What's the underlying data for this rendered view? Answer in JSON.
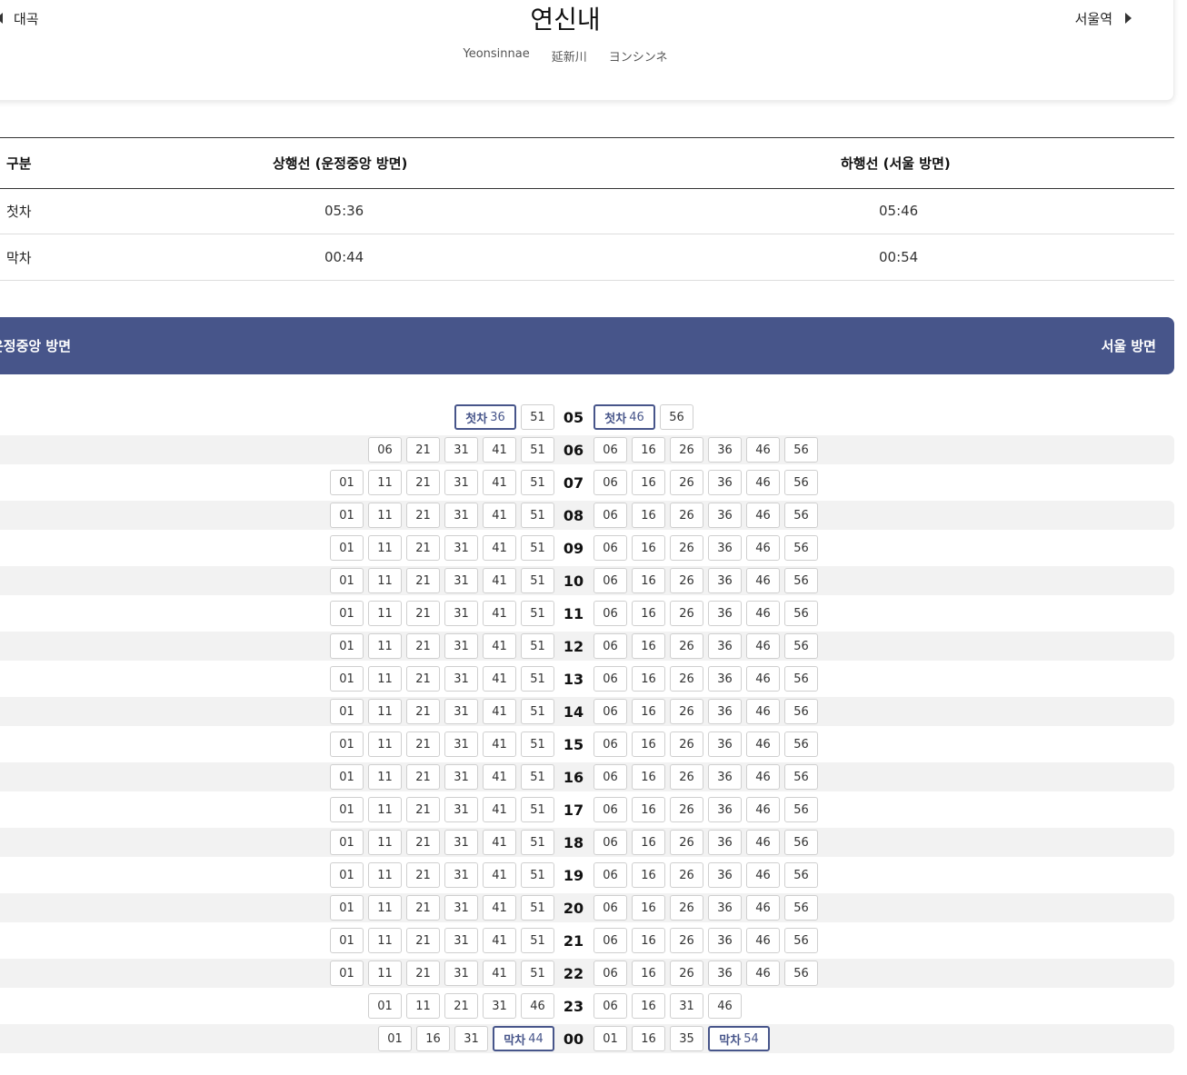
{
  "header": {
    "prev_station": "대곡",
    "next_station": "서울역",
    "title": "연신내",
    "sub_en": "Yeonsinnae",
    "sub_hanja": "延新川",
    "sub_jp": "ヨンシンネ"
  },
  "summary": {
    "headers": {
      "label": "구분",
      "up": "상행선 (운정중앙 방면)",
      "down": "하행선 (서울 방면)"
    },
    "first": {
      "label": "첫차",
      "up": "05:36",
      "down": "05:46"
    },
    "last": {
      "label": "막차",
      "up": "00:44",
      "down": "00:54"
    }
  },
  "direction_bar": {
    "left": "운정중앙 방면",
    "right": "서울 방면"
  },
  "first_tag": "첫차",
  "last_tag": "막차",
  "timetable": [
    {
      "hour": "05",
      "up": [
        "36",
        "51"
      ],
      "down": [
        "46",
        "56"
      ],
      "up_first": true,
      "down_first": true
    },
    {
      "hour": "06",
      "up": [
        "06",
        "21",
        "31",
        "41",
        "51"
      ],
      "down": [
        "06",
        "16",
        "26",
        "36",
        "46",
        "56"
      ]
    },
    {
      "hour": "07",
      "up": [
        "01",
        "11",
        "21",
        "31",
        "41",
        "51"
      ],
      "down": [
        "06",
        "16",
        "26",
        "36",
        "46",
        "56"
      ]
    },
    {
      "hour": "08",
      "up": [
        "01",
        "11",
        "21",
        "31",
        "41",
        "51"
      ],
      "down": [
        "06",
        "16",
        "26",
        "36",
        "46",
        "56"
      ]
    },
    {
      "hour": "09",
      "up": [
        "01",
        "11",
        "21",
        "31",
        "41",
        "51"
      ],
      "down": [
        "06",
        "16",
        "26",
        "36",
        "46",
        "56"
      ]
    },
    {
      "hour": "10",
      "up": [
        "01",
        "11",
        "21",
        "31",
        "41",
        "51"
      ],
      "down": [
        "06",
        "16",
        "26",
        "36",
        "46",
        "56"
      ]
    },
    {
      "hour": "11",
      "up": [
        "01",
        "11",
        "21",
        "31",
        "41",
        "51"
      ],
      "down": [
        "06",
        "16",
        "26",
        "36",
        "46",
        "56"
      ]
    },
    {
      "hour": "12",
      "up": [
        "01",
        "11",
        "21",
        "31",
        "41",
        "51"
      ],
      "down": [
        "06",
        "16",
        "26",
        "36",
        "46",
        "56"
      ]
    },
    {
      "hour": "13",
      "up": [
        "01",
        "11",
        "21",
        "31",
        "41",
        "51"
      ],
      "down": [
        "06",
        "16",
        "26",
        "36",
        "46",
        "56"
      ]
    },
    {
      "hour": "14",
      "up": [
        "01",
        "11",
        "21",
        "31",
        "41",
        "51"
      ],
      "down": [
        "06",
        "16",
        "26",
        "36",
        "46",
        "56"
      ]
    },
    {
      "hour": "15",
      "up": [
        "01",
        "11",
        "21",
        "31",
        "41",
        "51"
      ],
      "down": [
        "06",
        "16",
        "26",
        "36",
        "46",
        "56"
      ]
    },
    {
      "hour": "16",
      "up": [
        "01",
        "11",
        "21",
        "31",
        "41",
        "51"
      ],
      "down": [
        "06",
        "16",
        "26",
        "36",
        "46",
        "56"
      ]
    },
    {
      "hour": "17",
      "up": [
        "01",
        "11",
        "21",
        "31",
        "41",
        "51"
      ],
      "down": [
        "06",
        "16",
        "26",
        "36",
        "46",
        "56"
      ]
    },
    {
      "hour": "18",
      "up": [
        "01",
        "11",
        "21",
        "31",
        "41",
        "51"
      ],
      "down": [
        "06",
        "16",
        "26",
        "36",
        "46",
        "56"
      ]
    },
    {
      "hour": "19",
      "up": [
        "01",
        "11",
        "21",
        "31",
        "41",
        "51"
      ],
      "down": [
        "06",
        "16",
        "26",
        "36",
        "46",
        "56"
      ]
    },
    {
      "hour": "20",
      "up": [
        "01",
        "11",
        "21",
        "31",
        "41",
        "51"
      ],
      "down": [
        "06",
        "16",
        "26",
        "36",
        "46",
        "56"
      ]
    },
    {
      "hour": "21",
      "up": [
        "01",
        "11",
        "21",
        "31",
        "41",
        "51"
      ],
      "down": [
        "06",
        "16",
        "26",
        "36",
        "46",
        "56"
      ]
    },
    {
      "hour": "22",
      "up": [
        "01",
        "11",
        "21",
        "31",
        "41",
        "51"
      ],
      "down": [
        "06",
        "16",
        "26",
        "36",
        "46",
        "56"
      ]
    },
    {
      "hour": "23",
      "up": [
        "01",
        "11",
        "21",
        "31",
        "46"
      ],
      "down": [
        "06",
        "16",
        "31",
        "46"
      ]
    },
    {
      "hour": "00",
      "up": [
        "01",
        "16",
        "31",
        "44"
      ],
      "down": [
        "01",
        "16",
        "35",
        "54"
      ],
      "up_last": true,
      "down_last": true
    }
  ],
  "colors": {
    "accent": "#47558a",
    "row_alt": "#f2f2f2"
  }
}
